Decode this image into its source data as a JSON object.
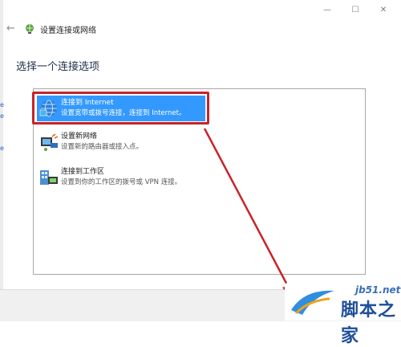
{
  "window": {
    "title": "设置连接或网络",
    "controls": {
      "minimize": "—",
      "maximize": "☐",
      "close": "✕"
    }
  },
  "heading": "选择一个连接选项",
  "options": [
    {
      "title": "连接到 Internet",
      "description": "设置宽带或拨号连接，连接到 Internet。",
      "icon": "globe-network-icon",
      "selected": true
    },
    {
      "title": "设置新网络",
      "description": "设置新的路由器或接入点。",
      "icon": "router-setup-icon",
      "selected": false
    },
    {
      "title": "连接到工作区",
      "description": "设置到你的工作区的拨号或 VPN 连接。",
      "icon": "workplace-vpn-icon",
      "selected": false
    }
  ],
  "watermark": {
    "url": "jb51.net",
    "name": "脚本之家"
  },
  "colors": {
    "selection": "#3399ff",
    "annotation": "#c8232a",
    "brand": "#1f4f9a"
  }
}
